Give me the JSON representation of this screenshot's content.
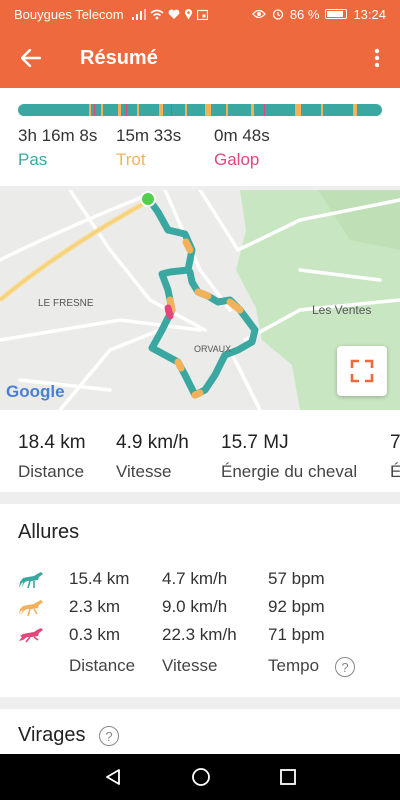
{
  "status_bar": {
    "carrier": "Bouygues Telecom",
    "battery": "86 %",
    "time": "13:24"
  },
  "app_bar": {
    "title": "Résumé"
  },
  "gaits": [
    {
      "time": "3h 16m 8s",
      "name": "Pas",
      "color": "#3aa8a0"
    },
    {
      "time": "15m 33s",
      "name": "Trot",
      "color": "#f3b25a"
    },
    {
      "time": "0m 48s",
      "name": "Galop",
      "color": "#e0487c"
    }
  ],
  "map": {
    "labels": {
      "le_fresne": "LE FRESNE",
      "les_ventes": "Les Ventes",
      "orvaux": "ORVAUX",
      "google": "Google"
    }
  },
  "stats": [
    {
      "value": "18.4 km",
      "label": "Distance"
    },
    {
      "value": "4.9 km/h",
      "label": "Vitesse"
    },
    {
      "value": "15.7 MJ",
      "label": "Énergie du cheval"
    },
    {
      "value": "7",
      "label": "É"
    }
  ],
  "allures": {
    "title": "Allures",
    "rows": [
      {
        "icon": "horse-walk-icon",
        "color": "#3aa8a0",
        "distance": "15.4 km",
        "speed": "4.7 km/h",
        "tempo": "57 bpm"
      },
      {
        "icon": "horse-trot-icon",
        "color": "#f3b25a",
        "distance": "2.3 km",
        "speed": "9.0 km/h",
        "tempo": "92 bpm"
      },
      {
        "icon": "horse-gallop-icon",
        "color": "#e0487c",
        "distance": "0.3 km",
        "speed": "22.3 km/h",
        "tempo": "71 bpm"
      }
    ],
    "col_labels": {
      "distance": "Distance",
      "speed": "Vitesse",
      "tempo": "Tempo"
    }
  },
  "virages": {
    "title": "Virages"
  },
  "help_glyph": "?",
  "colors": {
    "accent": "#ee6a3e",
    "walk": "#3aa8a0",
    "trot": "#f3b25a",
    "gallop": "#e0487c"
  }
}
